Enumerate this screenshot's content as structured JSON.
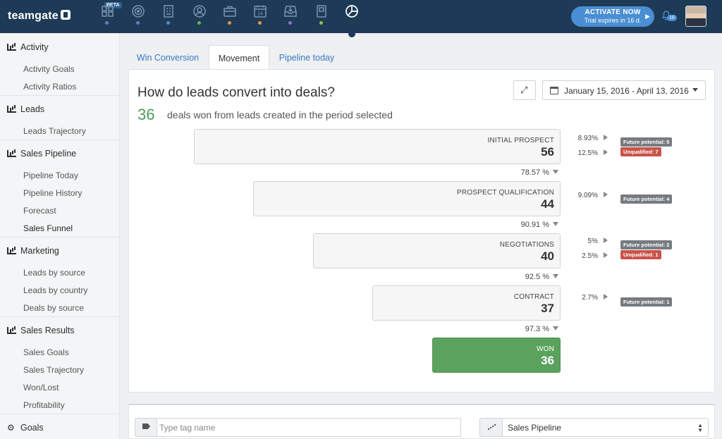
{
  "app": {
    "logo_text": "teamgate",
    "beta_label": "BETA",
    "activate_title": "ACTIVATE NOW",
    "activate_subtitle": "Trial expires in 16 d.",
    "notification_count": "18"
  },
  "nav_icons": [
    {
      "name": "dashboard-icon",
      "dot": "#7b6fd6"
    },
    {
      "name": "target-icon",
      "dot": "#7b6fd6"
    },
    {
      "name": "companies-icon",
      "dot": "#4a8ed3"
    },
    {
      "name": "contacts-icon",
      "dot": "#5fb35f"
    },
    {
      "name": "deals-icon",
      "dot": "#e09a3b"
    },
    {
      "name": "calendar-icon",
      "dot": "#e09a3b"
    },
    {
      "name": "inbox-icon",
      "dot": "#8b6fd6"
    },
    {
      "name": "documents-icon",
      "dot": "#8bc34a"
    },
    {
      "name": "reports-icon",
      "dot": null
    }
  ],
  "calendar_day": "14",
  "sidebar": {
    "sections": [
      {
        "label": "Activity",
        "items": [
          "Activity Goals",
          "Activity Ratios"
        ]
      },
      {
        "label": "Leads",
        "items": [
          "Leads Trajectory"
        ]
      },
      {
        "label": "Sales Pipeline",
        "items": [
          "Pipeline Today",
          "Pipeline History",
          "Forecast",
          "Sales Funnel"
        ]
      },
      {
        "label": "Marketing",
        "items": [
          "Leads by source",
          "Leads by country",
          "Deals by source"
        ]
      },
      {
        "label": "Sales Results",
        "items": [
          "Sales Goals",
          "Sales Trajectory",
          "Won/Lost",
          "Profitability"
        ]
      },
      {
        "label": "Goals",
        "items": []
      }
    ]
  },
  "tabs": [
    "Win Conversion",
    "Movement",
    "Pipeline today"
  ],
  "active_tab": "Movement",
  "main": {
    "title": "How do leads convert into deals?",
    "won_count": "36",
    "won_caption": "deals won from leads created in the period selected",
    "date_range": "January 15, 2016 - April 13, 2016"
  },
  "funnel": {
    "stages": [
      {
        "name": "INITIAL PROSPECT",
        "value": "56"
      },
      {
        "name": "PROSPECT QUALIFICATION",
        "value": "44"
      },
      {
        "name": "NEGOTIATIONS",
        "value": "40"
      },
      {
        "name": "CONTRACT",
        "value": "37"
      },
      {
        "name": "WON",
        "value": "36"
      }
    ],
    "conversions": [
      "78.57 %",
      "90.91 %",
      "92.5 %",
      "97.3 %"
    ],
    "side": [
      {
        "pcts": [
          "8.93%",
          "12.5%"
        ],
        "badges": [
          "Future potential: 5",
          "Unqualified: 7"
        ]
      },
      {
        "pcts": [
          "9.09%"
        ],
        "badges": [
          "Future potential: 4"
        ]
      },
      {
        "pcts": [
          "5%",
          "2.5%"
        ],
        "badges": [
          "Future potential: 2",
          "Unqualified: 1"
        ]
      },
      {
        "pcts": [
          "2.7%"
        ],
        "badges": [
          "Future potential: 1"
        ]
      }
    ],
    "colors": {
      "won": "#5aa25e",
      "future": "#767b80",
      "unqualified": "#c9534a"
    }
  },
  "filters": {
    "tag_placeholder": "Type tag name",
    "pipeline_value": "Sales Pipeline"
  }
}
